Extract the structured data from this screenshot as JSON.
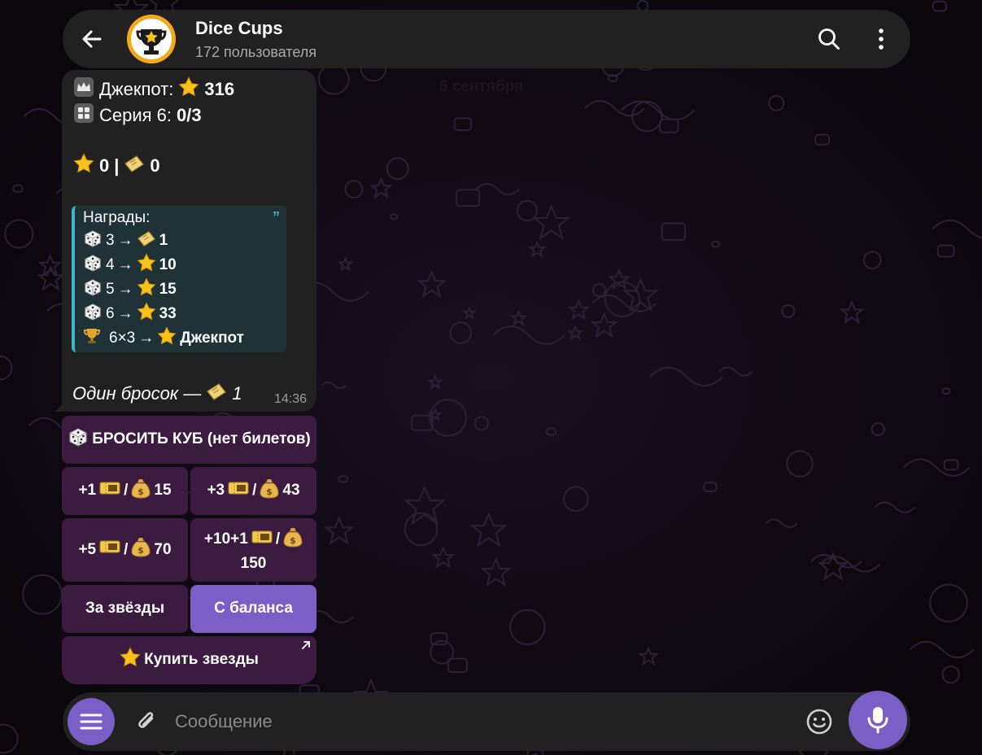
{
  "header": {
    "title": "Dice Cups",
    "subtitle": "172 пользователя",
    "icons": {
      "back": "arrow-left-icon",
      "avatar": "trophy-logo",
      "search": "search-icon",
      "more": "more-vertical-icon"
    }
  },
  "date_pill": "6 сентября",
  "message": {
    "jackpot_label": "Джекпот:",
    "jackpot_value": "316",
    "series_label": "Серия 6:",
    "series_value": "0/3",
    "stars_balance": "0",
    "separator": "|",
    "tickets_balance": "0",
    "rewards_title": "Награды:",
    "rewards": [
      {
        "roll": "3",
        "arrow": "→",
        "value": "1",
        "prize_icon": "ticket-icon"
      },
      {
        "roll": "4",
        "arrow": "→",
        "value": "10",
        "prize_icon": "star-icon"
      },
      {
        "roll": "5",
        "arrow": "→",
        "value": "15",
        "prize_icon": "star-icon"
      },
      {
        "roll": "6",
        "arrow": "→",
        "value": "33",
        "prize_icon": "star-icon"
      }
    ],
    "jackpot_reward": {
      "condition": "6×3",
      "arrow": "→",
      "value": "Джекпот"
    },
    "footer_text": "Один бросок —",
    "footer_value": "1",
    "time": "14:36"
  },
  "keyboard": {
    "roll_button": "БРОСИТЬ КУБ (нет билетов)",
    "packs": [
      {
        "tickets": "+1",
        "sep": "/",
        "price": "15"
      },
      {
        "tickets": "+3",
        "sep": "/",
        "price": "43"
      },
      {
        "tickets": "+5",
        "sep": "/",
        "price": "70"
      },
      {
        "tickets": "+10+1",
        "sep": "/",
        "price": "150"
      }
    ],
    "pay_stars": "За звёзды",
    "pay_balance": "С баланса",
    "buy_stars": "Купить звезды"
  },
  "composer": {
    "placeholder": "Сообщение",
    "icons": {
      "menu": "menu-icon",
      "attach": "paperclip-icon",
      "emoji": "emoji-icon",
      "mic": "microphone-icon"
    }
  },
  "colors": {
    "accent": "#7b5ec6",
    "panel": "#212121",
    "keyboard_button": "#3b1b3f",
    "quote_bg": "#1e3238",
    "quote_border": "#3fb6c8",
    "star": "#f7c21a",
    "background": "#0b070d"
  }
}
